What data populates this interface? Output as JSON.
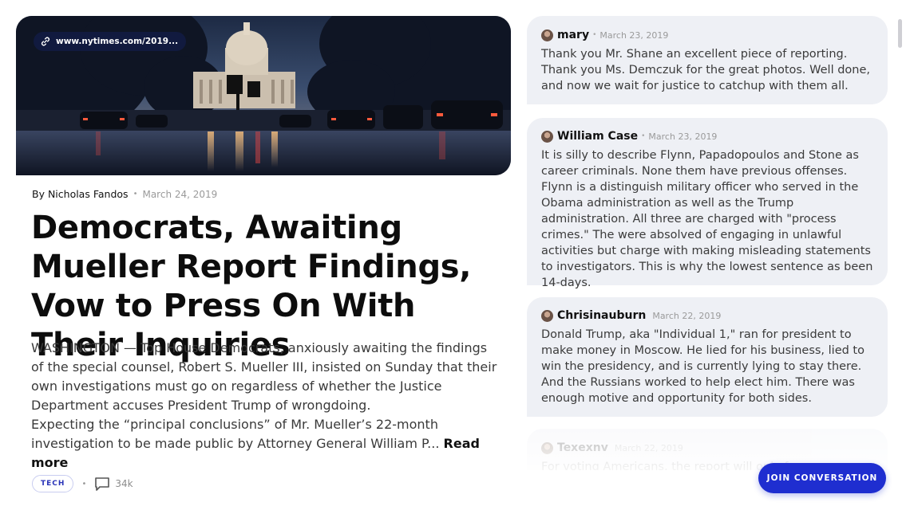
{
  "article": {
    "url": "www.nytimes.com/2019...",
    "author": "By Nicholas Fandos",
    "date": "March 24, 2019",
    "title": "Democrats, Awaiting Mueller Report Findings, Vow to Press On With Their Inquiries",
    "paragraph1": "WASHINGTON — Top House Democrats, anxiously awaiting the findings of the special counsel, Robert S. Mueller III, insisted on Sunday that their own investigations must go on regardless of whether the Justice Department accuses President Trump of wrongdoing.",
    "paragraph2": "Expecting the “principal conclusions” of Mr. Mueller’s 22-month investigation to be made public by Attorney General William P...",
    "read_more": "Read more",
    "tag": "TECH",
    "comment_count": "34k",
    "image_icon": "capitol-photo",
    "link_icon": "link-icon",
    "comment_icon": "comment-bubble-icon"
  },
  "comments": [
    {
      "name": "mary",
      "date": "March 23, 2019",
      "text": "Thank you Mr. Shane an excellent piece of reporting. Thank you Ms. Demczuk for the great photos. Well done, and now we wait for justice to catchup with them all."
    },
    {
      "name": "William Case",
      "date": "March 23, 2019",
      "text": "It is silly to describe Flynn, Papadopoulos and Stone as career criminals. None them have previous offenses. Flynn is a distinguish military officer who served in the Obama administration as well as the Trump administration. All three are charged with \"process crimes.\" The were absolved of engaging in unlawful activities but charge with making misleading statements to investigators. This is why the lowest sentence as been 14-days."
    },
    {
      "name": "Chrisinauburn",
      "date": "March 22, 2019",
      "text": "Donald Trump, aka \"Individual 1,\" ran for president to make money in Moscow. He lied for his business, lied to win the presidency, and is currently lying to stay there. And the Russians worked to help elect him. There was enough motive and opportunity for both sides."
    },
    {
      "name": "Texexnv",
      "date": "March 22, 2019",
      "text": "For voting Americans, the report will only fu..."
    }
  ],
  "join_button": "JOIN CONVERSATION",
  "colors": {
    "accent": "#1f2ed0",
    "comment_bg": "#eef0f5"
  }
}
